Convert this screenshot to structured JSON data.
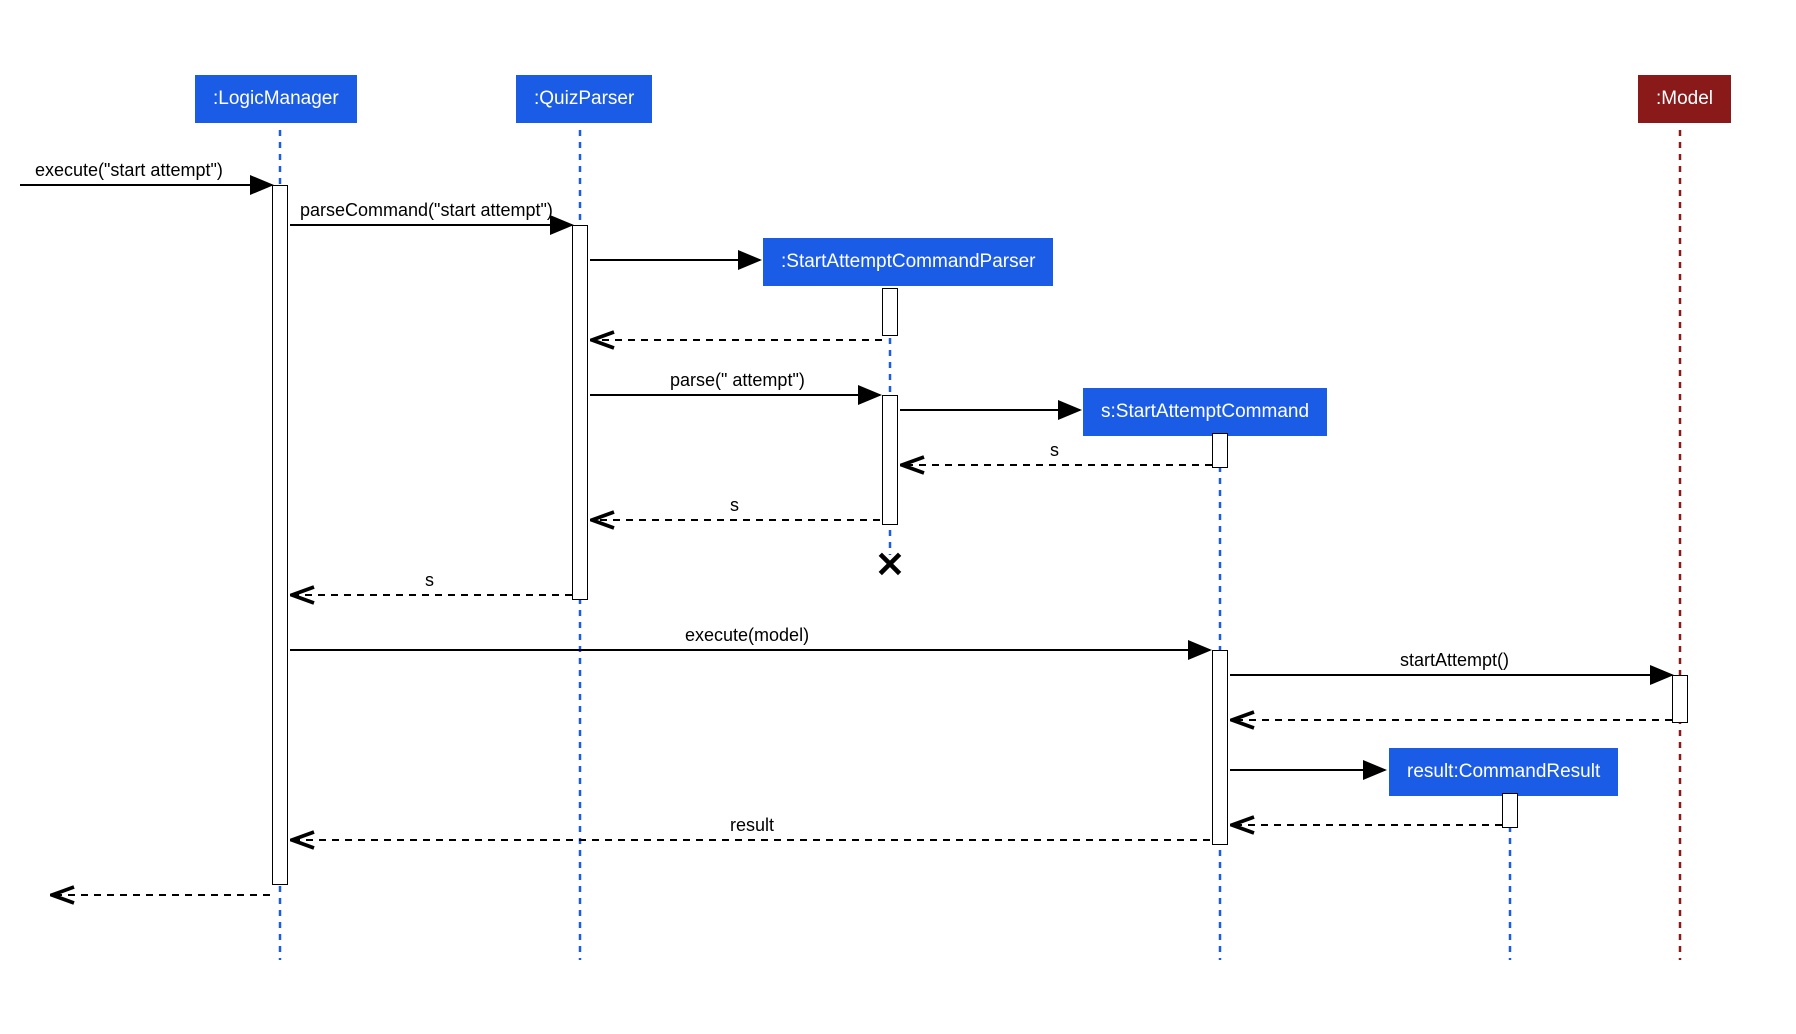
{
  "participants": {
    "logic_manager": ":LogicManager",
    "quiz_parser": ":QuizParser",
    "start_attempt_parser": ":StartAttemptCommandParser",
    "start_attempt_command": "s:StartAttemptCommand",
    "command_result": "result:CommandResult",
    "model": ":Model"
  },
  "messages": {
    "execute_start": "execute(\"start attempt\")",
    "parse_command": "parseCommand(\"start attempt\")",
    "parse_attempt": "parse(\" attempt\")",
    "s_label": "s",
    "execute_model": "execute(model)",
    "start_attempt": "startAttempt()",
    "result": "result"
  }
}
